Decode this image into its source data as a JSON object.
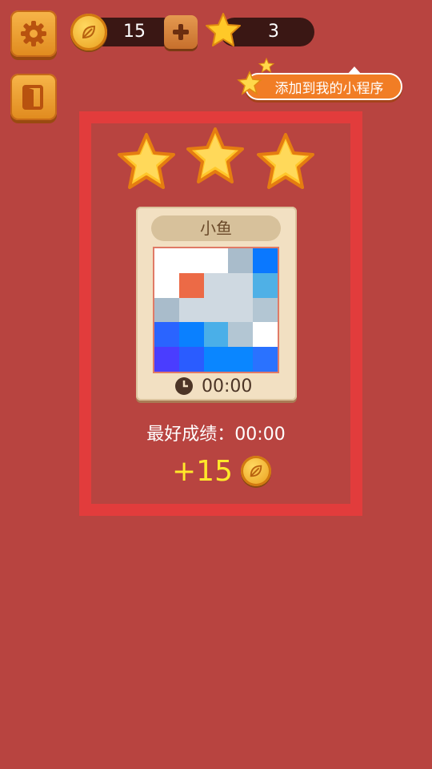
{
  "hud": {
    "coins": "15",
    "stars": "3",
    "mini_program_label": "添加到我的小程序"
  },
  "level": {
    "name": "小鱼",
    "time": "00:00",
    "stars_earned": 3,
    "best_label": "最好成绩：",
    "best_time": "00:00",
    "reward_text": "+15"
  },
  "grid_cells": [
    "#ffffff",
    "#ffffff",
    "#ffffff",
    "#a9bccb",
    "#0a78ff",
    "#ffffff",
    "#ec6a46",
    "#cfd9e1",
    "#cfd9e1",
    "#4fb0e6",
    "#a9bccb",
    "#cfd9e1",
    "#cfd9e1",
    "#cfd9e1",
    "#b3c6d3",
    "#2a64ff",
    "#0a80ff",
    "#4aafe8",
    "#b3c6d3",
    "#ffffff",
    "#4a3dff",
    "#2a5cff",
    "#0a86ff",
    "#0a86ff",
    "#2a72ff"
  ],
  "colors": {
    "background": "#b84440",
    "panel_border": "#e23c3c",
    "reward_text": "#ffe82a"
  },
  "icons": {
    "settings": "gear-icon",
    "exit": "door-exit-icon",
    "coin": "coin-icon",
    "add": "plus-icon",
    "star": "star-icon",
    "timer": "clock-icon"
  }
}
